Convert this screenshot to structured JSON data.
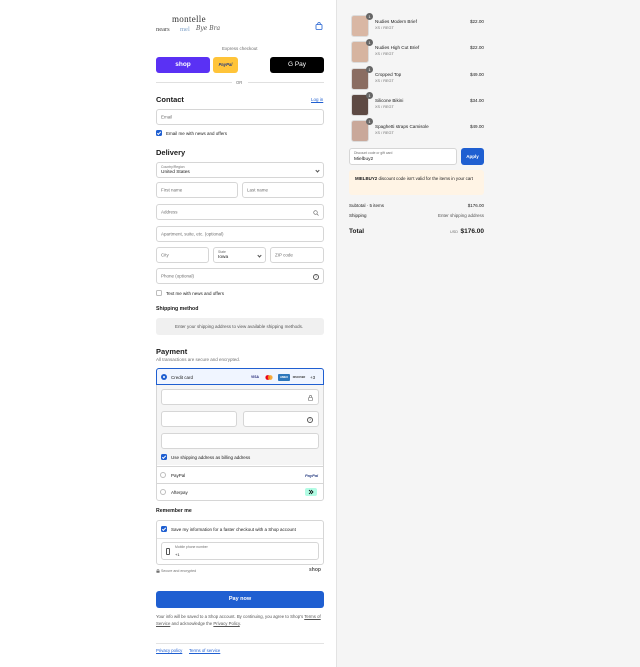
{
  "brand": {
    "logo_main": "montelle",
    "logo_sub1": "nears",
    "logo_sub2": "mel",
    "logo_sub3": "Bye Bra"
  },
  "express": {
    "label": "Express checkout",
    "shop_label": "shop",
    "paypal_label": "PayPal",
    "gpay_label": "G Pay",
    "or_label": "OR"
  },
  "contact": {
    "title": "Contact",
    "login_link": "Log in",
    "email_placeholder": "Email",
    "news_label": "Email me with news and offers"
  },
  "delivery": {
    "title": "Delivery",
    "country_label": "Country/Region",
    "country_value": "United States",
    "first_name": "First name",
    "last_name": "Last name",
    "address": "Address",
    "apartment": "Apartment, suite, etc. (optional)",
    "city": "City",
    "state_label": "State",
    "state_value": "Iowa",
    "zip": "ZIP code",
    "phone": "Phone (optional)",
    "text_me": "Text me with news and offers"
  },
  "shipping_method": {
    "title": "Shipping method",
    "info": "Enter your shipping address to view available shipping methods."
  },
  "payment": {
    "title": "Payment",
    "subtitle": "All transactions are secure and encrypted.",
    "credit_card": "Credit card",
    "more_cards": "+3",
    "card_logos": [
      "VISA",
      "MC",
      "AMEX",
      "DISCOVER"
    ],
    "billing_label": "Use shipping address as billing address",
    "paypal": "PayPal",
    "afterpay": "Afterpay"
  },
  "remember": {
    "title": "Remember me",
    "save_label": "Save my information for a faster checkout with a Shop account",
    "mobile_label": "Mobile phone number",
    "mobile_value": "+1",
    "secure_label": "Secure and encrypted",
    "shop_label": "shop"
  },
  "pay_button": "Pay now",
  "legal": {
    "text_before": "Your info will be saved to a Shop account. By continuing, you agree to Shop's",
    "terms": "Terms of Service",
    "and_text": "and acknowledge the",
    "privacy": "Privacy Policy",
    "end": "."
  },
  "footer": {
    "privacy": "Privacy policy",
    "terms": "Terms of service"
  },
  "cart": {
    "items": [
      {
        "qty": "1",
        "name": "Nudies Modern Brief",
        "variant": "XS / REGT",
        "price": "$22.00"
      },
      {
        "qty": "1",
        "name": "Nudies High Cut Brief",
        "variant": "XS / REGT",
        "price": "$22.00"
      },
      {
        "qty": "1",
        "name": "Cropped Top",
        "variant": "XS / REGT",
        "price": "$49.00"
      },
      {
        "qty": "1",
        "name": "Silicone Bikini",
        "variant": "XS / REGT",
        "price": "$34.00"
      },
      {
        "qty": "1",
        "name": "Spaghetti straps Camisole",
        "variant": "XS / REGT",
        "price": "$49.00"
      }
    ],
    "discount_label": "Discount code or gift card",
    "discount_value": "Mielbuy2",
    "apply": "Apply",
    "error_code": "MIELBUY2",
    "error_text": "discount code isn't valid for the items in your cart",
    "subtotal_label": "Subtotal · 5 items",
    "subtotal_value": "$176.00",
    "shipping_label": "Shipping",
    "shipping_value": "Enter shipping address",
    "total_label": "Total",
    "currency": "USD",
    "total_value": "$176.00"
  },
  "colors": {
    "accent": "#1f5fd1",
    "shop_purple": "#5a31f4",
    "paypal_yellow": "#ffc439",
    "error_bg": "#fff4e5"
  }
}
